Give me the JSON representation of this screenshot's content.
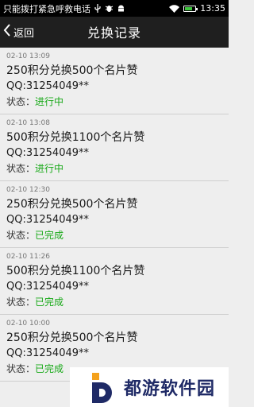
{
  "status_bar": {
    "carrier": "只能拨打紧急呼救电话",
    "time": "13:35",
    "icons": [
      "usb-icon",
      "bug-icon",
      "android-icon",
      "wifi-icon",
      "battery-icon"
    ],
    "battery_level": 0.7
  },
  "header": {
    "back_label": "返回",
    "title": "兑换记录"
  },
  "status_prefix": "状态：",
  "records": [
    {
      "time": "02-10 13:09",
      "desc": "250积分兑换500个名片赞",
      "qq": "QQ:31254049**",
      "status": "进行中"
    },
    {
      "time": "02-10 13:08",
      "desc": "500积分兑换1100个名片赞",
      "qq": "QQ:31254049**",
      "status": "进行中"
    },
    {
      "time": "02-10 12:30",
      "desc": "250积分兑换500个名片赞",
      "qq": "QQ:31254049**",
      "status": "已完成"
    },
    {
      "time": "02-10 11:26",
      "desc": "500积分兑换1100个名片赞",
      "qq": "QQ:31254049**",
      "status": "已完成"
    },
    {
      "time": "02-10 10:00",
      "desc": "250积分兑换500个名片赞",
      "qq": "QQ:31254049**",
      "status": "已完成"
    }
  ],
  "watermark": {
    "text": "都游软件园"
  },
  "colors": {
    "status_green": "#18a918",
    "nav_bg": "#1f1f1f",
    "list_bg": "#eeeeee"
  }
}
